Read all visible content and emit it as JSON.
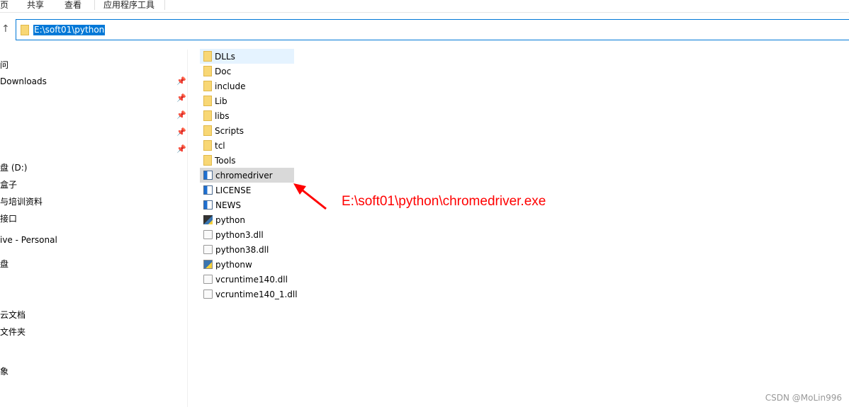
{
  "ribbon": {
    "tabs": [
      "页",
      "共享",
      "查看",
      "应用程序工具"
    ]
  },
  "address": {
    "path": "E:\\soft01\\python"
  },
  "sidebar": {
    "items": [
      "问",
      "Downloads",
      "盘 (D:)",
      "盒子",
      "与培训资料",
      "接口",
      "ive - Personal",
      "盘",
      "云文档",
      "文件夹",
      "象"
    ]
  },
  "files": [
    {
      "name": "DLLs",
      "type": "folder"
    },
    {
      "name": "Doc",
      "type": "folder"
    },
    {
      "name": "include",
      "type": "folder"
    },
    {
      "name": "Lib",
      "type": "folder"
    },
    {
      "name": "libs",
      "type": "folder"
    },
    {
      "name": "Scripts",
      "type": "folder"
    },
    {
      "name": "tcl",
      "type": "folder"
    },
    {
      "name": "Tools",
      "type": "folder"
    },
    {
      "name": "chromedriver",
      "type": "exe"
    },
    {
      "name": "LICENSE",
      "type": "exe"
    },
    {
      "name": "NEWS",
      "type": "exe"
    },
    {
      "name": "python",
      "type": "py"
    },
    {
      "name": "python3.dll",
      "type": "dll"
    },
    {
      "name": "python38.dll",
      "type": "dll"
    },
    {
      "name": "pythonw",
      "type": "pyw"
    },
    {
      "name": "vcruntime140.dll",
      "type": "dll"
    },
    {
      "name": "vcruntime140_1.dll",
      "type": "dll"
    }
  ],
  "annotation": {
    "text": "E:\\soft01\\python\\chromedriver.exe",
    "color": "#ff0000"
  },
  "watermark": "CSDN @MoLin996"
}
